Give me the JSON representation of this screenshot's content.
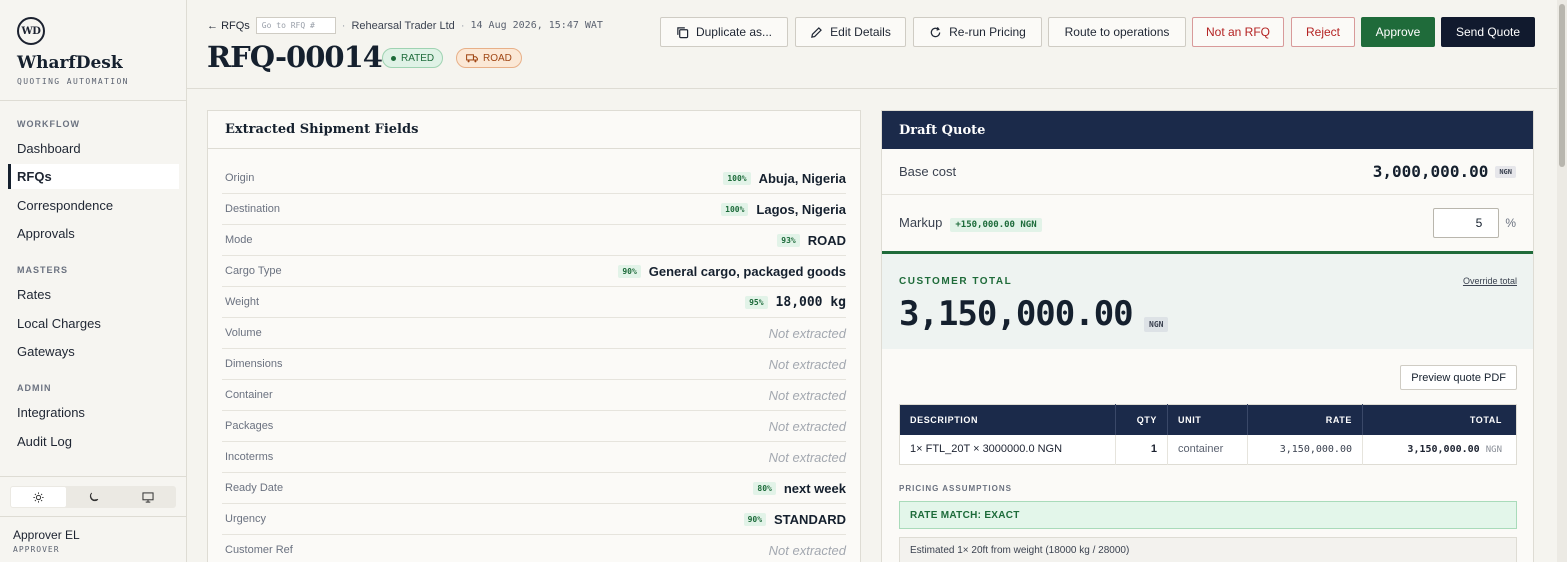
{
  "brand": {
    "mark": "WD",
    "name": "WharfDesk",
    "subtitle": "QUOTING AUTOMATION"
  },
  "sidebar": {
    "sections": [
      {
        "title": "WORKFLOW",
        "items": [
          "Dashboard",
          "RFQs",
          "Correspondence",
          "Approvals"
        ]
      },
      {
        "title": "MASTERS",
        "items": [
          "Rates",
          "Local Charges",
          "Gateways"
        ]
      },
      {
        "title": "ADMIN",
        "items": [
          "Integrations",
          "Audit Log"
        ]
      }
    ],
    "active": "RFQs",
    "theme_icons": [
      "sun-icon",
      "moon-icon",
      "monitor-icon"
    ],
    "user": {
      "name": "Approver EL",
      "role": "APPROVER"
    }
  },
  "header": {
    "back_label": "RFQs",
    "goto_placeholder": "Go to RFQ #",
    "client": "Rehearsal Trader Ltd",
    "datetime": "14 Aug 2026, 15:47 WAT",
    "title": "RFQ-00014",
    "status_badge": "RATED",
    "mode_badge": "ROAD",
    "buttons": {
      "duplicate": "Duplicate as...",
      "edit": "Edit Details",
      "rerun": "Re-run Pricing",
      "route": "Route to operations",
      "not_rfq": "Not an RFQ",
      "reject": "Reject",
      "approve": "Approve",
      "send": "Send Quote"
    }
  },
  "extracted": {
    "title": "Extracted Shipment Fields",
    "empty_text": "Not extracted",
    "fields": [
      {
        "label": "Origin",
        "confidence": "100%",
        "value": "Abuja, Nigeria"
      },
      {
        "label": "Destination",
        "confidence": "100%",
        "value": "Lagos, Nigeria"
      },
      {
        "label": "Mode",
        "confidence": "93%",
        "value": "ROAD"
      },
      {
        "label": "Cargo Type",
        "confidence": "90%",
        "value": "General cargo, packaged goods"
      },
      {
        "label": "Weight",
        "confidence": "95%",
        "value": "18,000 kg"
      },
      {
        "label": "Volume",
        "confidence": "",
        "value": ""
      },
      {
        "label": "Dimensions",
        "confidence": "",
        "value": ""
      },
      {
        "label": "Container",
        "confidence": "",
        "value": ""
      },
      {
        "label": "Packages",
        "confidence": "",
        "value": ""
      },
      {
        "label": "Incoterms",
        "confidence": "",
        "value": ""
      },
      {
        "label": "Ready Date",
        "confidence": "80%",
        "value": "next week"
      },
      {
        "label": "Urgency",
        "confidence": "90%",
        "value": "STANDARD"
      },
      {
        "label": "Customer Ref",
        "confidence": "",
        "value": ""
      }
    ]
  },
  "quote": {
    "title": "Draft Quote",
    "base_label": "Base cost",
    "base_amount": "3,000,000.00",
    "currency": "NGN",
    "markup_label": "Markup",
    "markup_delta": "+150,000.00 NGN",
    "markup_value": "5",
    "markup_unit": "%",
    "total_label": "CUSTOMER TOTAL",
    "override_label": "Override total",
    "total_amount": "3,150,000.00",
    "preview_pdf": "Preview quote PDF",
    "table_headers": [
      "DESCRIPTION",
      "QTY",
      "UNIT",
      "RATE",
      "TOTAL"
    ],
    "lines": [
      {
        "description": "1× FTL_20T × 3000000.0 NGN",
        "qty": "1",
        "unit": "container",
        "rate": "3,150,000.00",
        "total": "3,150,000.00",
        "currency": "NGN"
      }
    ],
    "assumptions_label": "PRICING ASSUMPTIONS",
    "rate_match": "RATE MATCH: EXACT",
    "assumption_note": "Estimated 1× 20ft from weight (18000 kg / 28000)"
  }
}
